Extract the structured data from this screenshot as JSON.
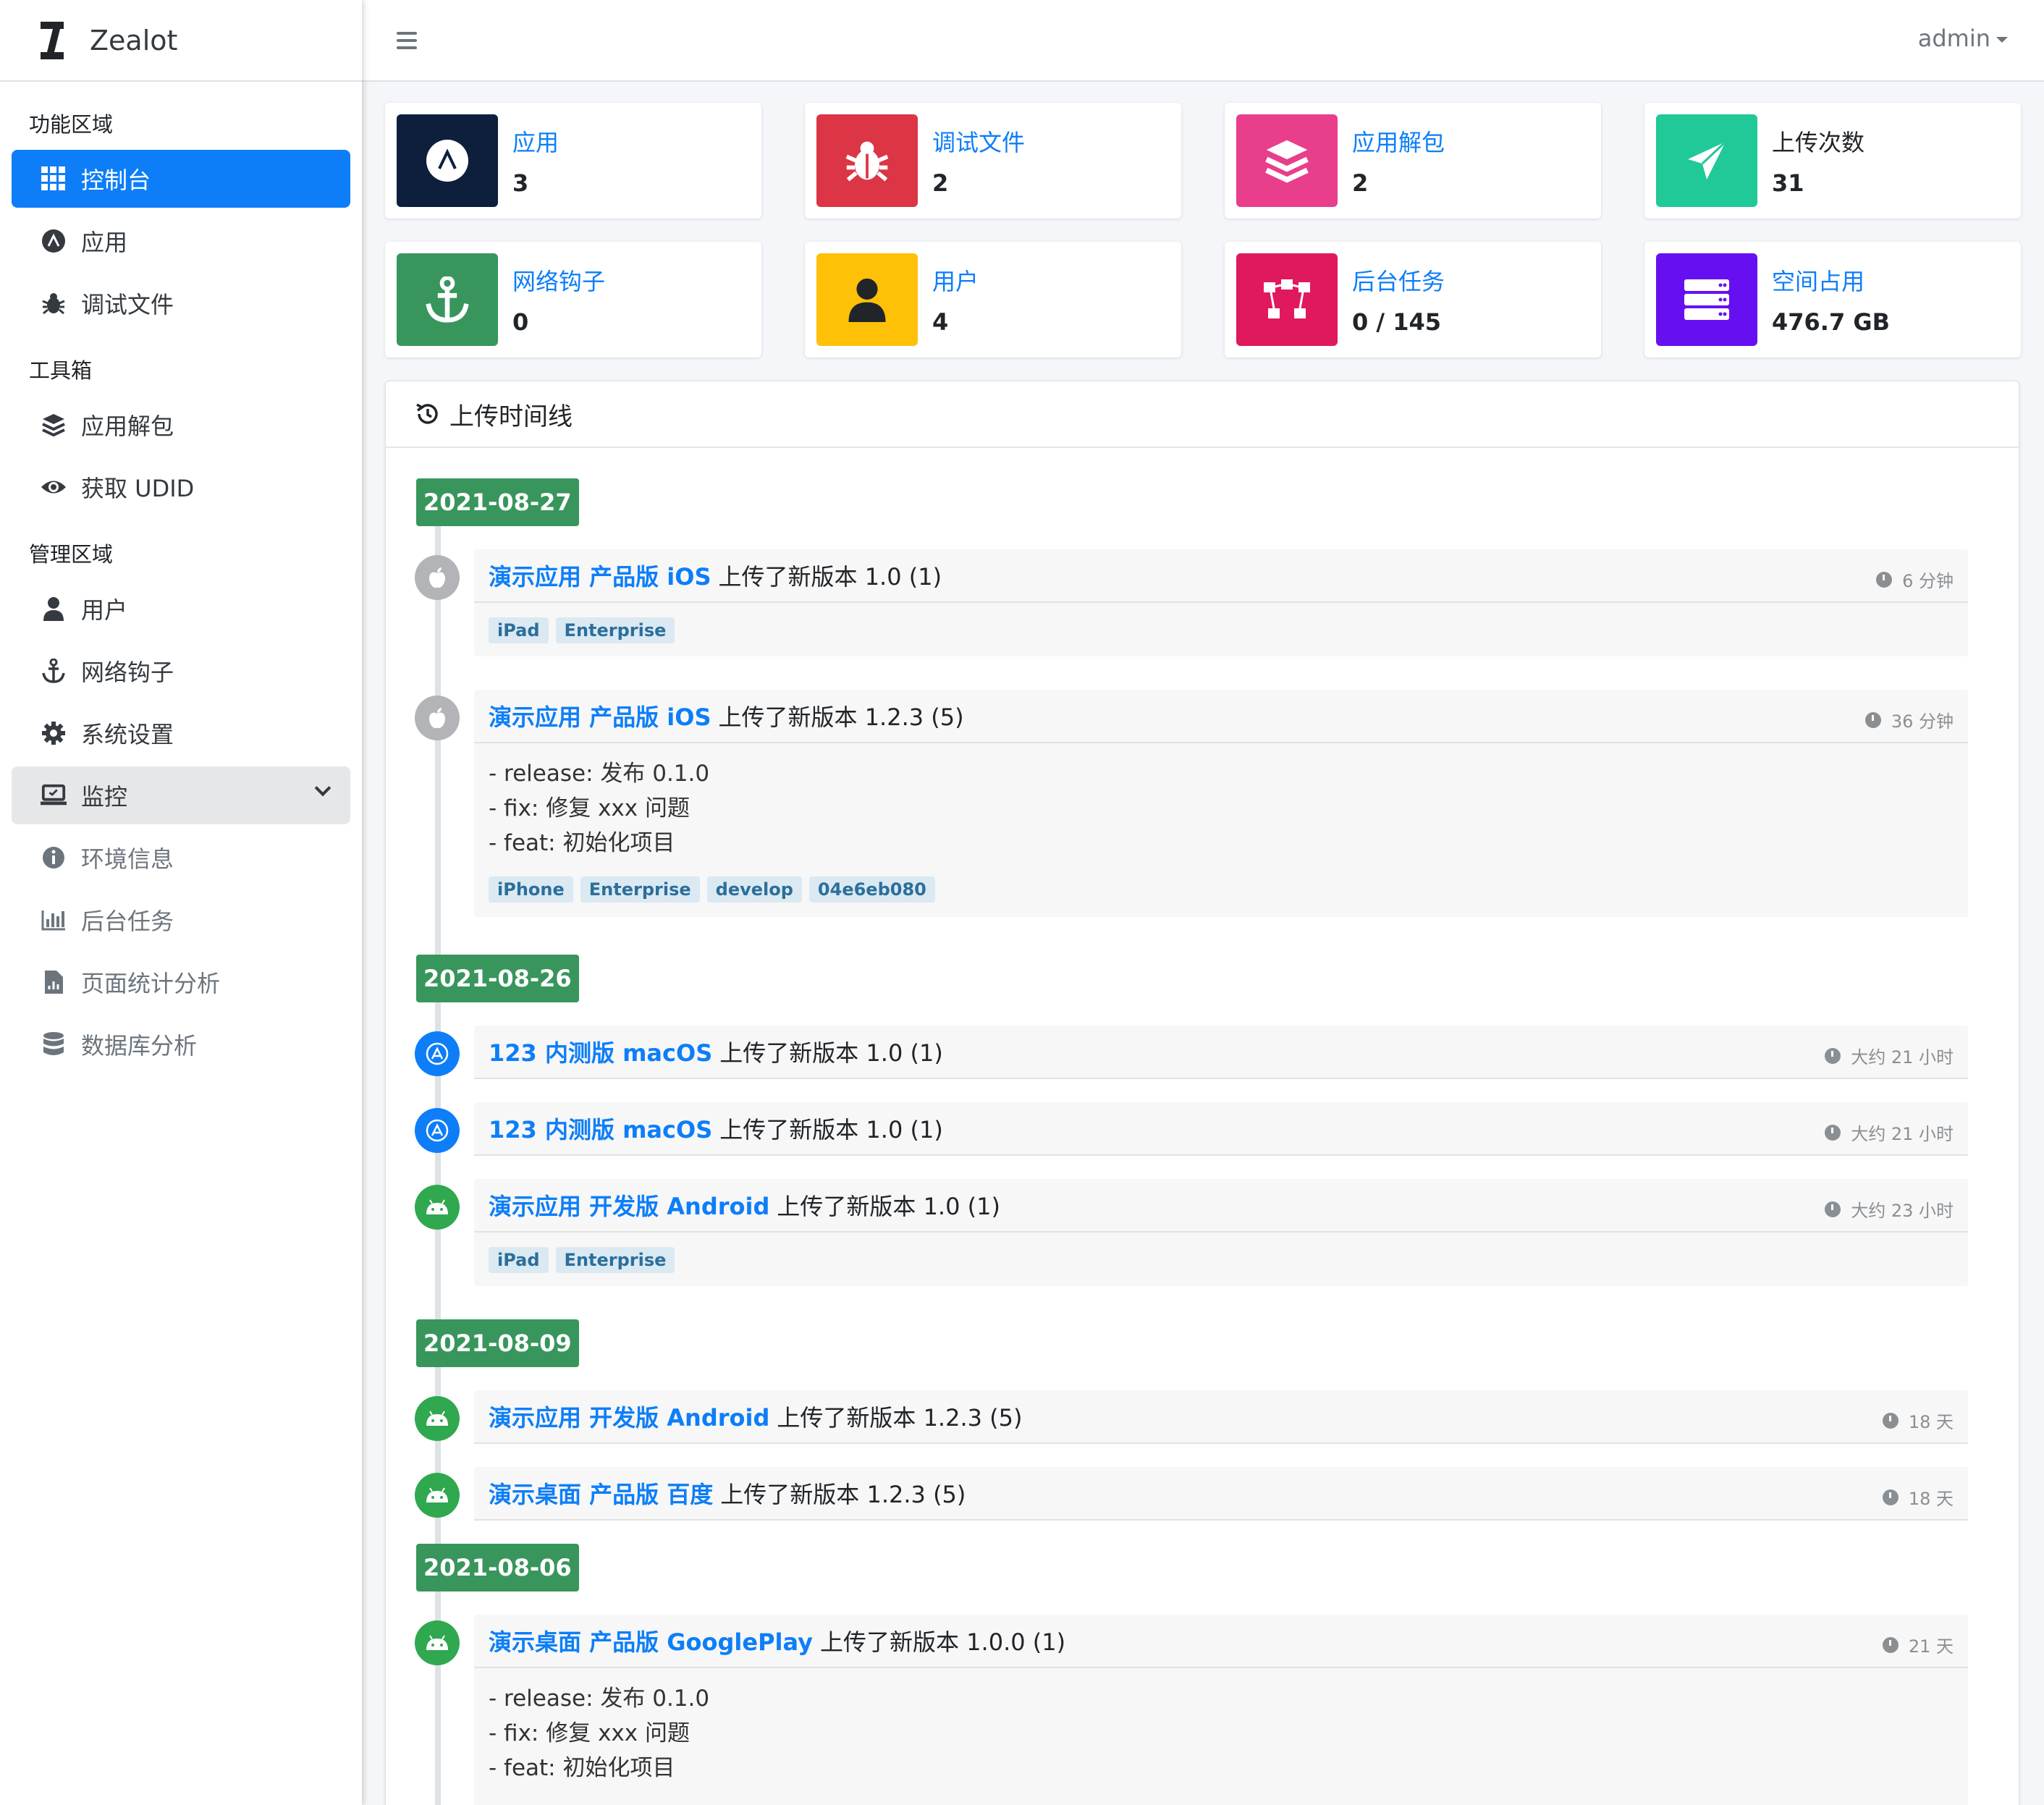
{
  "brand": {
    "name": "Zealot"
  },
  "topbar": {
    "user": "admin"
  },
  "sidebar": {
    "sections": [
      {
        "header": "功能区域",
        "items": [
          {
            "label": "控制台",
            "icon": "grid-icon",
            "active": true
          },
          {
            "label": "应用",
            "icon": "appstore-icon"
          },
          {
            "label": "调试文件",
            "icon": "bug-icon"
          }
        ]
      },
      {
        "header": "工具箱",
        "items": [
          {
            "label": "应用解包",
            "icon": "layers-icon"
          },
          {
            "label": "获取 UDID",
            "icon": "eye-icon"
          }
        ]
      },
      {
        "header": "管理区域",
        "items": [
          {
            "label": "用户",
            "icon": "user-icon"
          },
          {
            "label": "网络钩子",
            "icon": "anchor-icon"
          },
          {
            "label": "系统设置",
            "icon": "gear-icon"
          },
          {
            "label": "监控",
            "icon": "laptop-icon",
            "expanded": true
          },
          {
            "label": "环境信息",
            "icon": "info-icon",
            "sub": true
          },
          {
            "label": "后台任务",
            "icon": "bar-chart-icon",
            "sub": true
          },
          {
            "label": "页面统计分析",
            "icon": "file-chart-icon",
            "sub": true
          },
          {
            "label": "数据库分析",
            "icon": "database-icon",
            "sub": true
          }
        ]
      }
    ]
  },
  "stats": [
    {
      "label": "应用",
      "value": "3",
      "color": "#0d1f3c",
      "icon": "appstore-icon"
    },
    {
      "label": "调试文件",
      "value": "2",
      "color": "#dc3545",
      "icon": "bug-icon"
    },
    {
      "label": "应用解包",
      "value": "2",
      "color": "#e83e8c",
      "icon": "layers-icon"
    },
    {
      "label": "上传次数",
      "value": "31",
      "color": "#20c997",
      "icon": "paper-plane-icon"
    },
    {
      "label": "网络钩子",
      "value": "0",
      "color": "#38965c",
      "icon": "anchor-icon"
    },
    {
      "label": "用户",
      "value": "4",
      "color": "#ffc107",
      "icon": "user-icon"
    },
    {
      "label": "后台任务",
      "value": "0 / 145",
      "color": "#e0185e",
      "icon": "project-diagram-icon"
    },
    {
      "label": "空间占用",
      "value": "476.7 GB",
      "color": "#6610f2",
      "icon": "server-icon"
    }
  ],
  "timeline": {
    "title": "上传时间线",
    "dates": [
      "2021-08-27",
      "2021-08-26",
      "2021-08-09",
      "2021-08-06"
    ],
    "items": [
      {
        "platform": "ios",
        "link": "演示应用 产品版 iOS",
        "text": "上传了新版本 1.0 (1)",
        "time": "6 分钟",
        "tags": [
          "iPad",
          "Enterprise"
        ]
      },
      {
        "platform": "ios",
        "link": "演示应用 产品版 iOS",
        "text": "上传了新版本 1.2.3 (5)",
        "time": "36 分钟",
        "notes": [
          "- release: 发布 0.1.0",
          "- fix: 修复 xxx 问题",
          "- feat: 初始化项目"
        ],
        "tags": [
          "iPhone",
          "Enterprise",
          "develop",
          "04e6eb080"
        ]
      },
      {
        "platform": "macos",
        "link": "123 内测版 macOS",
        "text": "上传了新版本 1.0 (1)",
        "time": "大约 21 小时"
      },
      {
        "platform": "macos",
        "link": "123 内测版 macOS",
        "text": "上传了新版本 1.0 (1)",
        "time": "大约 21 小时"
      },
      {
        "platform": "android",
        "link": "演示应用 开发版 Android",
        "text": "上传了新版本 1.0 (1)",
        "time": "大约 23 小时",
        "tags": [
          "iPad",
          "Enterprise"
        ]
      },
      {
        "platform": "android",
        "link": "演示应用 开发版 Android",
        "text": "上传了新版本 1.2.3 (5)",
        "time": "18 天"
      },
      {
        "platform": "android",
        "link": "演示桌面 产品版 百度",
        "text": "上传了新版本 1.2.3 (5)",
        "time": "18 天"
      },
      {
        "platform": "android",
        "link": "演示桌面 产品版 GooglePlay",
        "text": "上传了新版本 1.0.0 (1)",
        "time": "21 天",
        "notes": [
          "- release: 发布 0.1.0",
          "- fix: 修复 xxx 问题",
          "- feat: 初始化项目"
        ]
      }
    ]
  }
}
